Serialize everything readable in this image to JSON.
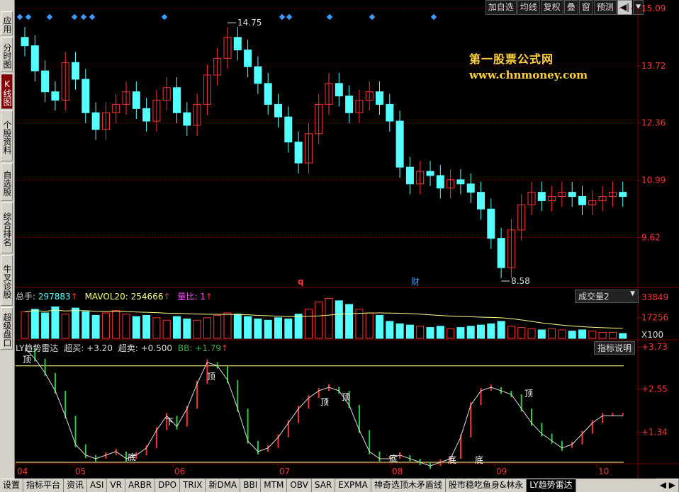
{
  "left_tabs": [
    "应用",
    "分时图",
    "K线图",
    "个股资料",
    "自选股",
    "综合排名",
    "牛叉诊股",
    "超级盘口"
  ],
  "active_left_tab": 2,
  "top_buttons": [
    "加自选",
    "均线",
    "复权",
    "叠",
    "窗",
    "预测"
  ],
  "top_icons": [
    "play-back-icon",
    "dropdown-icon"
  ],
  "watermark": {
    "title": "第一股票公式网",
    "url": "www.chnmoney.com"
  },
  "price_axis": [
    "15.09",
    "13.72",
    "12.36",
    "10.99",
    "9.62"
  ],
  "price_high_label": "14.75",
  "price_low_label": "8.58",
  "markers": {
    "q": "q",
    "cai": "财"
  },
  "volume_panel": {
    "label_total": "总手:",
    "value_total": "297883",
    "label_mavol": "MAVOL20:",
    "value_mavol": "254666",
    "label_ratio": "量比:",
    "value_ratio": "1",
    "dropdown": "成交量2",
    "axis": [
      "33849",
      "17256"
    ],
    "axis_unit": "X100"
  },
  "indicator_panel": {
    "name": "LY趋势雷达",
    "label_overbuy": "超买:",
    "value_overbuy": "+3.20",
    "label_oversell": "超卖:",
    "value_oversell": "+0.500",
    "label_bb": "BB:",
    "value_bb": "+1.79",
    "explain_button": "指标说明",
    "axis": [
      "+3.73",
      "+2.55",
      "+1.34"
    ],
    "signals": [
      "顶",
      "顶",
      "顶",
      "顶",
      "顶",
      "下",
      "底",
      "底",
      "底",
      "底"
    ]
  },
  "date_axis": [
    "04",
    "05",
    "06",
    "07",
    "08",
    "09",
    "10"
  ],
  "bottom_tabs": [
    "设置",
    "指标平台",
    "资讯",
    "ASI",
    "VR",
    "ARBR",
    "DPO",
    "TRIX",
    "新DMA",
    "BBI",
    "MTM",
    "OBV",
    "SAR",
    "EXPMA",
    "神奇选顶木矛盾线",
    "股市稳吃鱼身&林永",
    "LY趋势雷达"
  ],
  "active_bottom_tab": 16,
  "colors": {
    "up": "#ff3232",
    "down": "#54ffff",
    "ma": "#ffff80",
    "grid": "#800000",
    "bg": "#000000"
  },
  "chart_data": [
    {
      "type": "candlestick",
      "title": "",
      "ylim": [
        8.58,
        15.09
      ],
      "high": 14.75,
      "low": 8.58,
      "close_sequence": [
        14.2,
        13.6,
        13.1,
        12.9,
        13.8,
        13.4,
        12.6,
        12.2,
        12.6,
        12.8,
        13.1,
        12.7,
        12.4,
        12.9,
        13.2,
        12.6,
        12.3,
        12.8,
        13.5,
        13.9,
        14.4,
        14.1,
        13.7,
        13.3,
        12.8,
        12.5,
        11.9,
        11.4,
        12.1,
        12.8,
        13.3,
        13.0,
        12.6,
        12.9,
        13.1,
        12.8,
        12.4,
        11.3,
        10.9,
        11.2,
        11.1,
        10.8,
        11.0,
        10.9,
        10.7,
        10.3,
        9.6,
        8.9,
        9.8,
        10.4,
        10.7,
        10.5,
        10.6,
        10.7,
        10.6,
        10.4,
        10.5,
        10.6,
        10.7,
        10.6
      ]
    },
    {
      "type": "bar",
      "title": "成交量",
      "ylim": [
        0,
        33849
      ],
      "ma_label": "MAVOL20",
      "values": [
        22000,
        24000,
        21000,
        26000,
        20000,
        25000,
        22000,
        19000,
        21000,
        23000,
        20000,
        18000,
        19000,
        17000,
        15000,
        18000,
        16000,
        15000,
        17000,
        19000,
        21000,
        20000,
        18000,
        16000,
        15000,
        17000,
        16000,
        20000,
        24000,
        30000,
        33000,
        31000,
        28000,
        24000,
        21000,
        19000,
        14000,
        12000,
        11000,
        10000,
        9000,
        10000,
        8000,
        9000,
        10000,
        11000,
        12000,
        14000,
        10000,
        9000,
        8000,
        7000,
        8000,
        7000,
        6000,
        7000,
        6000,
        5000,
        5000,
        4000
      ]
    },
    {
      "type": "line",
      "title": "LY趋势雷达",
      "ylim": [
        0.5,
        3.73
      ],
      "series": [
        {
          "name": "BB",
          "values": [
            3.7,
            3.4,
            3.0,
            2.5,
            1.8,
            1.0,
            0.7,
            0.6,
            0.7,
            0.8,
            0.6,
            0.7,
            0.9,
            1.4,
            1.8,
            1.5,
            2.0,
            2.7,
            3.3,
            3.2,
            2.8,
            2.0,
            1.1,
            0.8,
            0.9,
            1.2,
            1.6,
            2.0,
            2.3,
            2.5,
            2.6,
            2.5,
            2.1,
            1.4,
            0.8,
            0.6,
            0.6,
            0.7,
            0.6,
            0.5,
            0.4,
            0.5,
            0.6,
            1.2,
            2.1,
            2.5,
            2.6,
            2.5,
            2.4,
            2.0,
            1.6,
            1.3,
            1.1,
            0.9,
            1.0,
            1.3,
            1.6,
            1.8,
            1.8,
            1.8
          ]
        }
      ]
    }
  ]
}
